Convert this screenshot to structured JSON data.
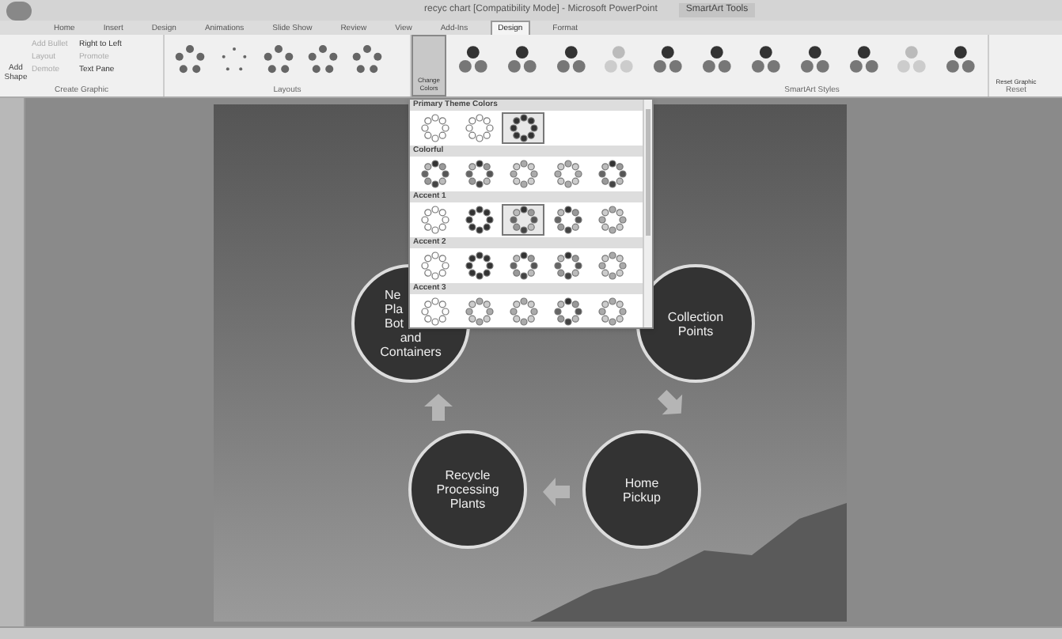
{
  "window": {
    "title": "recyc chart [Compatibility Mode] - Microsoft PowerPoint",
    "context_tab_group": "SmartArt Tools"
  },
  "ribbon_tabs": [
    {
      "label": "Home",
      "selected": false
    },
    {
      "label": "Insert",
      "selected": false
    },
    {
      "label": "Design",
      "selected": false
    },
    {
      "label": "Animations",
      "selected": false
    },
    {
      "label": "Slide Show",
      "selected": false
    },
    {
      "label": "Review",
      "selected": false
    },
    {
      "label": "View",
      "selected": false
    },
    {
      "label": "Add-Ins",
      "selected": false
    },
    {
      "label": "Design",
      "selected": true
    },
    {
      "label": "Format",
      "selected": false
    }
  ],
  "create_graphic": {
    "large_button": "Add Shape",
    "small_buttons": [
      {
        "label": "Add Bullet",
        "disabled": true
      },
      {
        "label": "Right to Left",
        "disabled": false
      },
      {
        "label": "Layout",
        "disabled": true
      },
      {
        "label": "Promote",
        "disabled": true
      },
      {
        "label": "Demote",
        "disabled": true
      },
      {
        "label": "Text Pane",
        "disabled": false
      }
    ],
    "group_label": "Create Graphic"
  },
  "layouts": {
    "group_label": "Layouts"
  },
  "change_colors": {
    "label": "Change Colors"
  },
  "styles": {
    "group_label": "SmartArt Styles"
  },
  "reset": {
    "label": "Reset Graphic",
    "group_label": "Reset"
  },
  "color_menu": {
    "sections": [
      {
        "title": "Primary Theme Colors",
        "swatches": [
          {
            "kind": "outline",
            "highlighted": false
          },
          {
            "kind": "outline",
            "highlighted": false
          },
          {
            "kind": "dark",
            "highlighted": true
          }
        ]
      },
      {
        "title": "Colorful",
        "swatches": [
          {
            "kind": "mixed",
            "highlighted": false
          },
          {
            "kind": "mixed",
            "highlighted": false
          },
          {
            "kind": "light",
            "highlighted": false
          },
          {
            "kind": "light",
            "highlighted": false
          },
          {
            "kind": "mixed",
            "highlighted": false
          }
        ]
      },
      {
        "title": "Accent 1",
        "swatches": [
          {
            "kind": "outline",
            "highlighted": false
          },
          {
            "kind": "dark",
            "highlighted": false
          },
          {
            "kind": "mixed",
            "highlighted": true
          },
          {
            "kind": "mixed",
            "highlighted": false
          },
          {
            "kind": "light",
            "highlighted": false
          }
        ]
      },
      {
        "title": "Accent 2",
        "swatches": [
          {
            "kind": "outline",
            "highlighted": false
          },
          {
            "kind": "dark",
            "highlighted": false
          },
          {
            "kind": "mixed",
            "highlighted": false
          },
          {
            "kind": "mixed",
            "highlighted": false
          },
          {
            "kind": "light",
            "highlighted": false
          }
        ]
      },
      {
        "title": "Accent 3",
        "swatches": [
          {
            "kind": "outline",
            "highlighted": false
          },
          {
            "kind": "light",
            "highlighted": false
          },
          {
            "kind": "light",
            "highlighted": false
          },
          {
            "kind": "mixed",
            "highlighted": false
          },
          {
            "kind": "light",
            "highlighted": false
          }
        ]
      }
    ]
  },
  "cycle": [
    {
      "covered_lines": [
        "Ne",
        "Pla",
        "Bot"
      ],
      "lines": [
        "and",
        "Containers"
      ]
    },
    {
      "lines": [
        "Collection",
        "Points"
      ]
    },
    {
      "lines": [
        "Recycle",
        "Processing",
        "Plants"
      ]
    },
    {
      "lines": [
        "Home",
        "Pickup"
      ]
    }
  ]
}
